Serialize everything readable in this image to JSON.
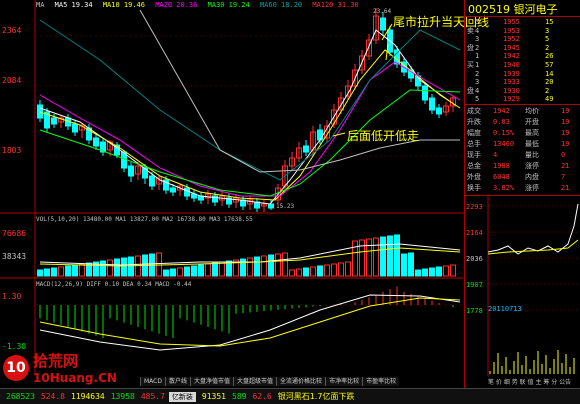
{
  "chart_header": {
    "ma_label": "MA",
    "ma5": "MA5 19.34",
    "ma10": "MA10 19.46",
    "ma20": "MA20 20.36",
    "ma30": "MA30 19.24",
    "ma60": "MA60 18.20",
    "ma120": "MA120 31.30"
  },
  "y_axis": [
    "2364",
    "2084",
    "1803"
  ],
  "price_marks": {
    "high": "23.64",
    "low": "15.23"
  },
  "annotations": {
    "top": "尾市拉升当天回线",
    "mid": "后面低开低走"
  },
  "volume_header": "VOL(5,10,20) 13480.00 MA1 13827.00 MA2 16738.80 MA3 17638.55",
  "volume_y": [
    "76686",
    "38343"
  ],
  "macd_header": "MACD(12,26,9) DIFF 0.10 DEA 0.34 MACD -0.44",
  "macd_y": [
    "1.30",
    "-1.30"
  ],
  "logo": {
    "number": "10",
    "cn": "拾荒网",
    "en": "10Huang.CN"
  },
  "indicator_tabs": [
    "MACD",
    "散户线",
    "大盘净值市值",
    "大盘超级市值",
    "全流通价格比较",
    "市净率比较",
    "市盈率比较"
  ],
  "status_bar": {
    "index1": "268523",
    "change1": "524.8",
    "vol1": "1194634",
    "change2": "13958",
    "index2": "485.7",
    "btn": "亿新装",
    "vol2": "91351",
    "change3": "589",
    "index3": "62.6",
    "news": "银河黑石1.7亿面下跌"
  },
  "stock": {
    "code": "002519",
    "name": "银河电子"
  },
  "order_book": {
    "sell": [
      {
        "side": "",
        "level": "5",
        "price": "1955",
        "vol": "15"
      },
      {
        "side": "卖",
        "level": "4",
        "price": "1953",
        "vol": "3"
      },
      {
        "side": "",
        "level": "3",
        "price": "1952",
        "vol": "5"
      },
      {
        "side": "盘",
        "level": "2",
        "price": "1945",
        "vol": "2"
      },
      {
        "side": "",
        "level": "1",
        "price": "1942",
        "vol": "26"
      }
    ],
    "buy": [
      {
        "side": "买",
        "level": "1",
        "price": "1940",
        "vol": "57"
      },
      {
        "side": "",
        "level": "2",
        "price": "1939",
        "vol": "14"
      },
      {
        "side": "",
        "level": "3",
        "price": "1933",
        "vol": "20"
      },
      {
        "side": "盘",
        "level": "4",
        "price": "1930",
        "vol": "2"
      },
      {
        "side": "",
        "level": "5",
        "price": "1929",
        "vol": "49"
      }
    ]
  },
  "quotes": [
    {
      "l1": "成交",
      "v1": "1942",
      "l2": "均价",
      "v2": "19"
    },
    {
      "l1": "升跌",
      "v1": "0.03",
      "l2": "开盘",
      "v2": "19"
    },
    {
      "l1": "幅度",
      "v1": "0.15%",
      "l2": "最高",
      "v2": "19"
    },
    {
      "l1": "总手",
      "v1": "13460",
      "l2": "最低",
      "v2": "19"
    },
    {
      "l1": "现手",
      "v1": "4",
      "l2": "量比",
      "v2": "0"
    },
    {
      "l1": "总金",
      "v1": "1988",
      "l2": "涨停",
      "v2": "21"
    },
    {
      "l1": "外盘",
      "v1": "6048",
      "l2": "内盘",
      "v2": "7"
    },
    {
      "l1": "换手",
      "v1": "3.82%",
      "l2": "涨停",
      "v2": "21"
    }
  ],
  "mini_chart": {
    "y": [
      "2293",
      "2164",
      "2036",
      "1907",
      "1778"
    ],
    "date": "20110713",
    "tabs": "笔 价 细 势 联 值 主 筹 分 公告"
  },
  "colors": {
    "up": "#ff3030",
    "down": "#00ffff",
    "ma5": "#ffffff",
    "ma10": "#ffff00",
    "ma20": "#ff00ff",
    "ma30": "#00ff00",
    "ma60": "#008080",
    "ma120": "#c0c0c0"
  }
}
